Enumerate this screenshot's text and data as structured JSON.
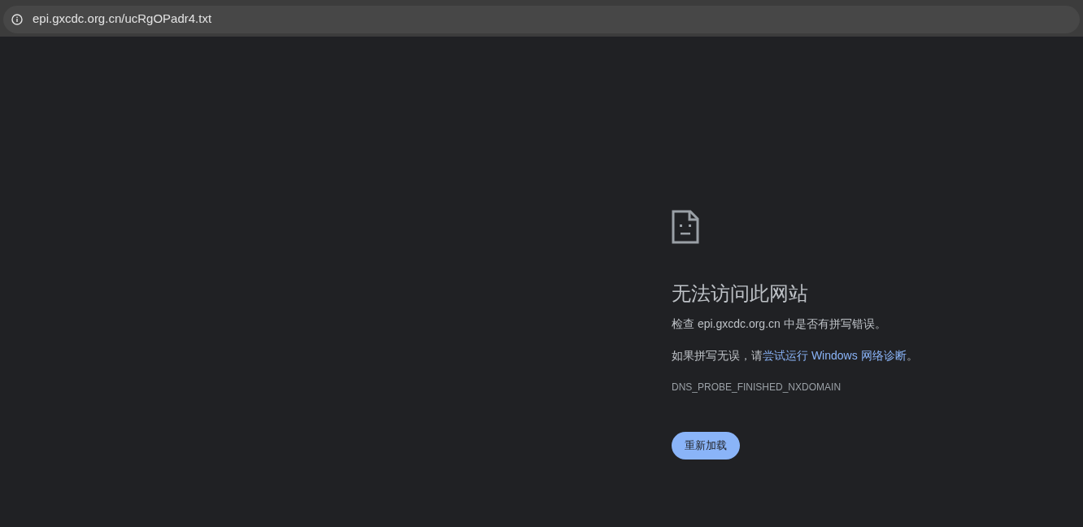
{
  "address_bar": {
    "url": "epi.gxcdc.org.cn/ucRgOPadr4.txt"
  },
  "error": {
    "title": "无法访问此网站",
    "message": "检查 epi.gxcdc.org.cn 中是否有拼写错误。",
    "suggestion_prefix": "如果拼写无误，请",
    "suggestion_link": "尝试运行 Windows 网络诊断",
    "suggestion_suffix": "。",
    "code": "DNS_PROBE_FINISHED_NXDOMAIN",
    "reload_button": "重新加载"
  }
}
